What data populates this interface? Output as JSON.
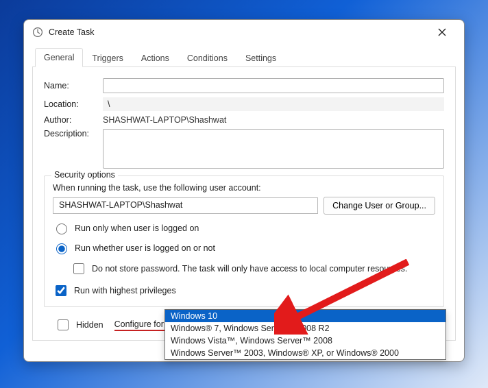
{
  "window": {
    "title": "Create Task"
  },
  "tabs": [
    "General",
    "Triggers",
    "Actions",
    "Conditions",
    "Settings"
  ],
  "active_tab": 0,
  "labels": {
    "name": "Name:",
    "location": "Location:",
    "author": "Author:",
    "description": "Description:",
    "hidden": "Hidden",
    "configure_for": "Configure for:"
  },
  "values": {
    "name": "",
    "location": "\\",
    "author": "SHASHWAT-LAPTOP\\Shashwat",
    "description": ""
  },
  "security": {
    "legend": "Security options",
    "prompt": "When running the task, use the following user account:",
    "user": "SHASHWAT-LAPTOP\\Shashwat",
    "change_btn": "Change User or Group...",
    "radio_logged_on": "Run only when user is logged on",
    "radio_whether": "Run whether user is logged on or not",
    "store_pw": "Do not store password.  The task will only have access to local computer resources.",
    "highest": "Run with highest privileges",
    "selected_radio": "whether",
    "store_pw_checked": false,
    "highest_checked": true,
    "hidden_checked": false
  },
  "configure": {
    "selected": "Windows Vista™, Windows Server™ 2008",
    "options": [
      "Windows 10",
      "Windows® 7, Windows Server™ 2008 R2",
      "Windows Vista™, Windows Server™ 2008",
      "Windows Server™ 2003, Windows® XP, or Windows® 2000"
    ],
    "highlight_index": 0
  }
}
